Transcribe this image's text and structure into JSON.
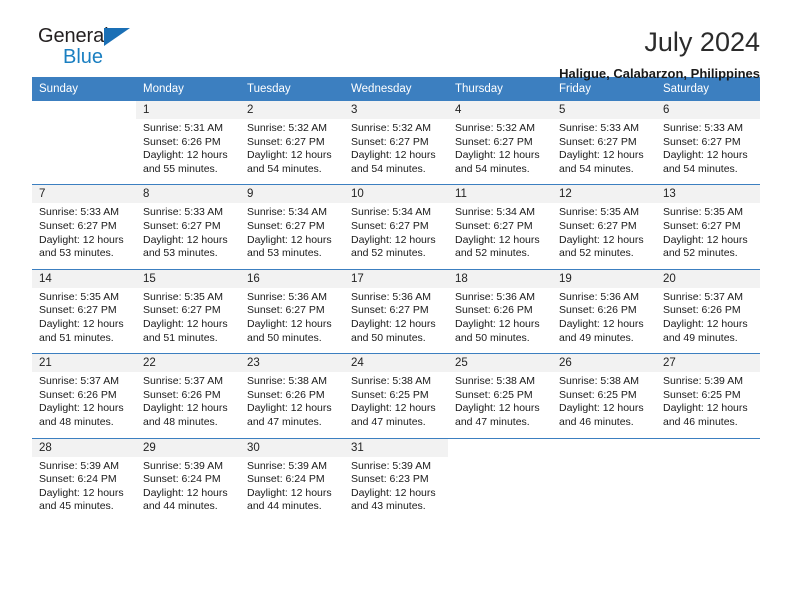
{
  "brand": {
    "logo_line1": "General",
    "logo_line2": "Blue",
    "logo_icon": "triangle-icon",
    "accent_color": "#1a7fc1",
    "header_color": "#3c7fc0"
  },
  "header": {
    "title": "July 2024",
    "subtitle": "Haligue, Calabarzon, Philippines"
  },
  "weekday_headers": [
    "Sunday",
    "Monday",
    "Tuesday",
    "Wednesday",
    "Thursday",
    "Friday",
    "Saturday"
  ],
  "weeks": [
    [
      {
        "day": "",
        "sunrise": "",
        "sunset": "",
        "daylight": "",
        "daylight2": ""
      },
      {
        "day": "1",
        "sunrise": "Sunrise: 5:31 AM",
        "sunset": "Sunset: 6:26 PM",
        "daylight": "Daylight: 12 hours",
        "daylight2": "and 55 minutes."
      },
      {
        "day": "2",
        "sunrise": "Sunrise: 5:32 AM",
        "sunset": "Sunset: 6:27 PM",
        "daylight": "Daylight: 12 hours",
        "daylight2": "and 54 minutes."
      },
      {
        "day": "3",
        "sunrise": "Sunrise: 5:32 AM",
        "sunset": "Sunset: 6:27 PM",
        "daylight": "Daylight: 12 hours",
        "daylight2": "and 54 minutes."
      },
      {
        "day": "4",
        "sunrise": "Sunrise: 5:32 AM",
        "sunset": "Sunset: 6:27 PM",
        "daylight": "Daylight: 12 hours",
        "daylight2": "and 54 minutes."
      },
      {
        "day": "5",
        "sunrise": "Sunrise: 5:33 AM",
        "sunset": "Sunset: 6:27 PM",
        "daylight": "Daylight: 12 hours",
        "daylight2": "and 54 minutes."
      },
      {
        "day": "6",
        "sunrise": "Sunrise: 5:33 AM",
        "sunset": "Sunset: 6:27 PM",
        "daylight": "Daylight: 12 hours",
        "daylight2": "and 54 minutes."
      }
    ],
    [
      {
        "day": "7",
        "sunrise": "Sunrise: 5:33 AM",
        "sunset": "Sunset: 6:27 PM",
        "daylight": "Daylight: 12 hours",
        "daylight2": "and 53 minutes."
      },
      {
        "day": "8",
        "sunrise": "Sunrise: 5:33 AM",
        "sunset": "Sunset: 6:27 PM",
        "daylight": "Daylight: 12 hours",
        "daylight2": "and 53 minutes."
      },
      {
        "day": "9",
        "sunrise": "Sunrise: 5:34 AM",
        "sunset": "Sunset: 6:27 PM",
        "daylight": "Daylight: 12 hours",
        "daylight2": "and 53 minutes."
      },
      {
        "day": "10",
        "sunrise": "Sunrise: 5:34 AM",
        "sunset": "Sunset: 6:27 PM",
        "daylight": "Daylight: 12 hours",
        "daylight2": "and 52 minutes."
      },
      {
        "day": "11",
        "sunrise": "Sunrise: 5:34 AM",
        "sunset": "Sunset: 6:27 PM",
        "daylight": "Daylight: 12 hours",
        "daylight2": "and 52 minutes."
      },
      {
        "day": "12",
        "sunrise": "Sunrise: 5:35 AM",
        "sunset": "Sunset: 6:27 PM",
        "daylight": "Daylight: 12 hours",
        "daylight2": "and 52 minutes."
      },
      {
        "day": "13",
        "sunrise": "Sunrise: 5:35 AM",
        "sunset": "Sunset: 6:27 PM",
        "daylight": "Daylight: 12 hours",
        "daylight2": "and 52 minutes."
      }
    ],
    [
      {
        "day": "14",
        "sunrise": "Sunrise: 5:35 AM",
        "sunset": "Sunset: 6:27 PM",
        "daylight": "Daylight: 12 hours",
        "daylight2": "and 51 minutes."
      },
      {
        "day": "15",
        "sunrise": "Sunrise: 5:35 AM",
        "sunset": "Sunset: 6:27 PM",
        "daylight": "Daylight: 12 hours",
        "daylight2": "and 51 minutes."
      },
      {
        "day": "16",
        "sunrise": "Sunrise: 5:36 AM",
        "sunset": "Sunset: 6:27 PM",
        "daylight": "Daylight: 12 hours",
        "daylight2": "and 50 minutes."
      },
      {
        "day": "17",
        "sunrise": "Sunrise: 5:36 AM",
        "sunset": "Sunset: 6:27 PM",
        "daylight": "Daylight: 12 hours",
        "daylight2": "and 50 minutes."
      },
      {
        "day": "18",
        "sunrise": "Sunrise: 5:36 AM",
        "sunset": "Sunset: 6:26 PM",
        "daylight": "Daylight: 12 hours",
        "daylight2": "and 50 minutes."
      },
      {
        "day": "19",
        "sunrise": "Sunrise: 5:36 AM",
        "sunset": "Sunset: 6:26 PM",
        "daylight": "Daylight: 12 hours",
        "daylight2": "and 49 minutes."
      },
      {
        "day": "20",
        "sunrise": "Sunrise: 5:37 AM",
        "sunset": "Sunset: 6:26 PM",
        "daylight": "Daylight: 12 hours",
        "daylight2": "and 49 minutes."
      }
    ],
    [
      {
        "day": "21",
        "sunrise": "Sunrise: 5:37 AM",
        "sunset": "Sunset: 6:26 PM",
        "daylight": "Daylight: 12 hours",
        "daylight2": "and 48 minutes."
      },
      {
        "day": "22",
        "sunrise": "Sunrise: 5:37 AM",
        "sunset": "Sunset: 6:26 PM",
        "daylight": "Daylight: 12 hours",
        "daylight2": "and 48 minutes."
      },
      {
        "day": "23",
        "sunrise": "Sunrise: 5:38 AM",
        "sunset": "Sunset: 6:26 PM",
        "daylight": "Daylight: 12 hours",
        "daylight2": "and 47 minutes."
      },
      {
        "day": "24",
        "sunrise": "Sunrise: 5:38 AM",
        "sunset": "Sunset: 6:25 PM",
        "daylight": "Daylight: 12 hours",
        "daylight2": "and 47 minutes."
      },
      {
        "day": "25",
        "sunrise": "Sunrise: 5:38 AM",
        "sunset": "Sunset: 6:25 PM",
        "daylight": "Daylight: 12 hours",
        "daylight2": "and 47 minutes."
      },
      {
        "day": "26",
        "sunrise": "Sunrise: 5:38 AM",
        "sunset": "Sunset: 6:25 PM",
        "daylight": "Daylight: 12 hours",
        "daylight2": "and 46 minutes."
      },
      {
        "day": "27",
        "sunrise": "Sunrise: 5:39 AM",
        "sunset": "Sunset: 6:25 PM",
        "daylight": "Daylight: 12 hours",
        "daylight2": "and 46 minutes."
      }
    ],
    [
      {
        "day": "28",
        "sunrise": "Sunrise: 5:39 AM",
        "sunset": "Sunset: 6:24 PM",
        "daylight": "Daylight: 12 hours",
        "daylight2": "and 45 minutes."
      },
      {
        "day": "29",
        "sunrise": "Sunrise: 5:39 AM",
        "sunset": "Sunset: 6:24 PM",
        "daylight": "Daylight: 12 hours",
        "daylight2": "and 44 minutes."
      },
      {
        "day": "30",
        "sunrise": "Sunrise: 5:39 AM",
        "sunset": "Sunset: 6:24 PM",
        "daylight": "Daylight: 12 hours",
        "daylight2": "and 44 minutes."
      },
      {
        "day": "31",
        "sunrise": "Sunrise: 5:39 AM",
        "sunset": "Sunset: 6:23 PM",
        "daylight": "Daylight: 12 hours",
        "daylight2": "and 43 minutes."
      },
      {
        "day": "",
        "sunrise": "",
        "sunset": "",
        "daylight": "",
        "daylight2": ""
      },
      {
        "day": "",
        "sunrise": "",
        "sunset": "",
        "daylight": "",
        "daylight2": ""
      },
      {
        "day": "",
        "sunrise": "",
        "sunset": "",
        "daylight": "",
        "daylight2": ""
      }
    ]
  ]
}
